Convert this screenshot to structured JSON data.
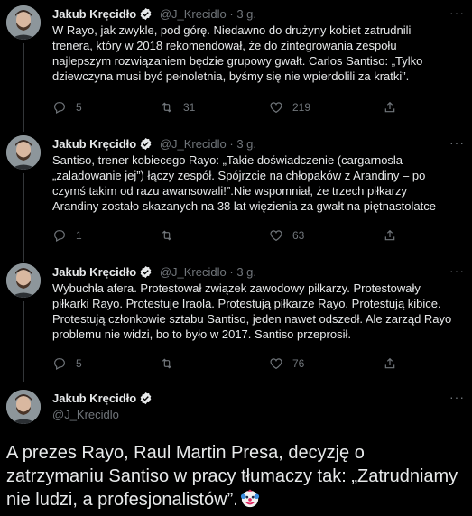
{
  "tweets": [
    {
      "name": "Jakub Kręcidło",
      "handle": "@J_Krecidlo",
      "dot": "·",
      "time": "3 g.",
      "text": "W Rayo, jak zwykle, pod górę. Niedawno do drużyny kobiet zatrudnili trenera, który w 2018 rekomendował, że do zintegrowania zespołu najlepszym rozwiązaniem będzie grupowy gwałt. Carlos Santiso: „Tylko dziewczyna musi być pełnoletnia, byśmy się nie wpierdolili za kratki”.",
      "replies": "5",
      "retweets": "31",
      "likes": "219"
    },
    {
      "name": "Jakub Kręcidło",
      "handle": "@J_Krecidlo",
      "dot": "·",
      "time": "3 g.",
      "text": "Santiso, trener kobiecego Rayo: „Takie doświadczenie (cargarnosla – „zaladowanie jej”) łączy zespół. Spójrzcie na chłopaków z Arandiny – po czymś takim od razu awansowali!”.Nie wspomniał, że trzech piłkarzy Arandiny zostało skazanych na 38 lat więzienia za gwałt na piętnastolatce",
      "replies": "1",
      "retweets": "",
      "likes": "63"
    },
    {
      "name": "Jakub Kręcidło",
      "handle": "@J_Krecidlo",
      "dot": "·",
      "time": "3 g.",
      "text": "Wybuchła afera. Protestował związek zawodowy piłkarzy. Protestowały piłkarki Rayo. Protestuje Iraola. Protestują piłkarze Rayo. Protestują kibice. Protestują członkowie sztabu Santiso, jeden nawet odszedł. Ale zarząd Rayo problemu nie widzi, bo to było w 2017. Santiso przeprosił.",
      "replies": "5",
      "retweets": "",
      "likes": "76"
    }
  ],
  "main_tweet": {
    "name": "Jakub Kręcidło",
    "handle": "@J_Krecidlo",
    "text": "A prezes Rayo, Raul Martin Presa, decyzję o zatrzymaniu Santiso w pracy tłumaczy tak: „Zatrudniamy nie ludzi, a profesjonalistów”.",
    "emoji": "clown-face"
  },
  "more_label": "···",
  "colors": {
    "background": "#000000",
    "text": "#e7e9ea",
    "muted": "#71767b",
    "verified": "#e7e9ea",
    "divider": "#2f3336"
  }
}
